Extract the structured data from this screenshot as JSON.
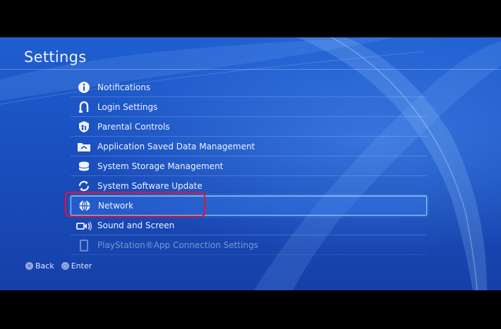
{
  "header": {
    "title": "Settings"
  },
  "menu": {
    "items": [
      {
        "label": "Notifications",
        "icon": "info-icon"
      },
      {
        "label": "Login Settings",
        "icon": "login-icon"
      },
      {
        "label": "Parental Controls",
        "icon": "parental-controls-icon"
      },
      {
        "label": "Application Saved Data Management",
        "icon": "saved-data-icon"
      },
      {
        "label": "System Storage Management",
        "icon": "storage-icon"
      },
      {
        "label": "System Software Update",
        "icon": "update-icon"
      },
      {
        "label": "Network",
        "icon": "globe-icon",
        "selected": true
      },
      {
        "label": "Sound and Screen",
        "icon": "sound-screen-icon"
      },
      {
        "label": "PlayStation®App Connection Settings",
        "icon": "phone-icon"
      }
    ]
  },
  "footer": {
    "back_label": "Back",
    "enter_label": "Enter",
    "back_glyph": "✕",
    "enter_glyph": "○"
  },
  "colors": {
    "background": "#1a4fbf",
    "text": "#eef3ff",
    "highlight": "#e8122a"
  }
}
